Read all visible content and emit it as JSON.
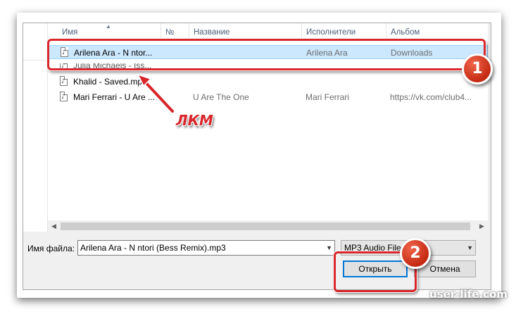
{
  "columns": {
    "name": "Имя",
    "number": "№",
    "title": "Название",
    "artists": "Исполнители",
    "album": "Альбом"
  },
  "files": [
    {
      "name": "Arilena Ara - N ntor...",
      "title": "",
      "artist": "Arilena Ara",
      "album": "Downloads",
      "selected": true
    },
    {
      "name": "Julia Michaels - Iss...",
      "title": "",
      "artist": "",
      "album": "",
      "partial": true
    },
    {
      "name": "Khalid - Saved.mp3",
      "title": "",
      "artist": "",
      "album": ""
    },
    {
      "name": "Mari Ferrari - U Are ...",
      "title": "U Are The One",
      "artist": "Mari Ferrari",
      "album": "https://vk.com/club4..."
    }
  ],
  "filename_label": "Имя файла:",
  "filename_value": "Arilena Ara - N ntori (Bess Remix).mp3",
  "filetype_value": "MP3 Audio File",
  "buttons": {
    "open": "Открыть",
    "cancel": "Отмена"
  },
  "annotations": {
    "badge1": "1",
    "badge2": "2",
    "click_label": "ЛКМ",
    "accent_color": "#d8262b"
  },
  "watermark": "user-life.com"
}
